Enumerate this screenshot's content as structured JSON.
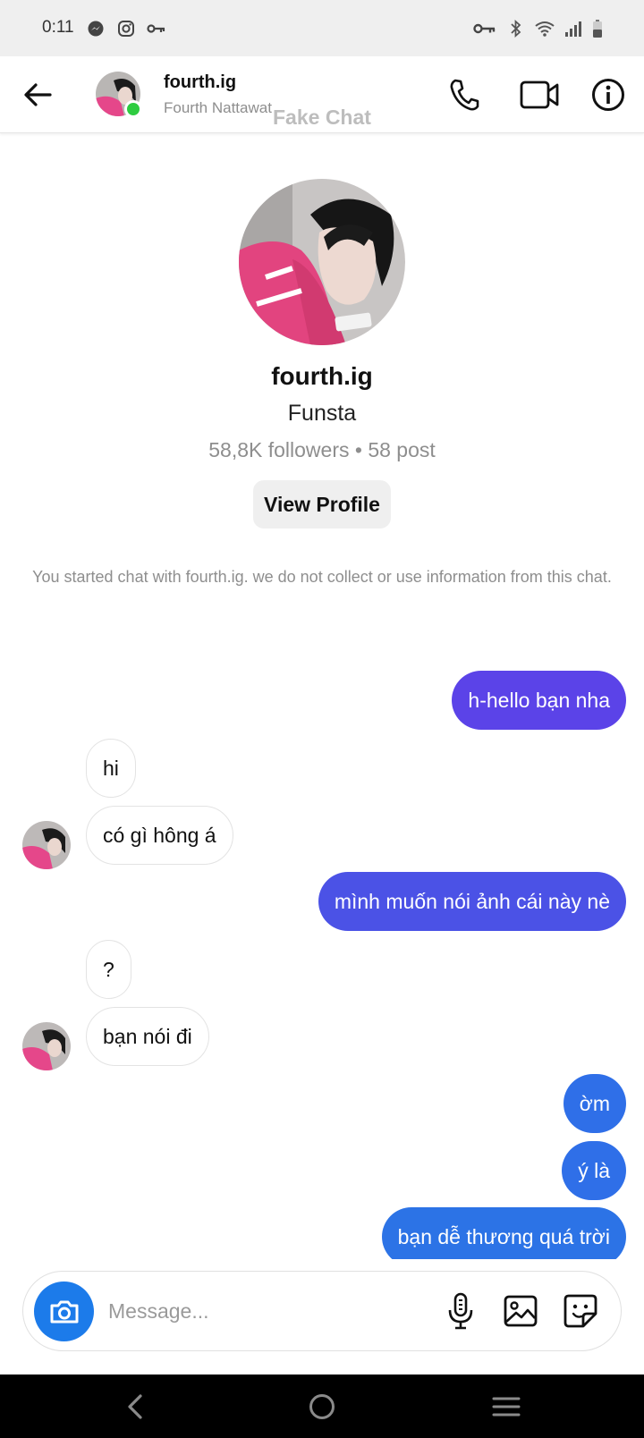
{
  "status_bar": {
    "time": "0:11",
    "left_icons": [
      "messenger-icon",
      "instagram-icon",
      "key-icon"
    ],
    "right_icons": [
      "vpn-key-icon",
      "bluetooth-icon",
      "wifi-icon",
      "signal-icon",
      "battery-icon"
    ]
  },
  "header": {
    "name": "fourth.ig",
    "subtitle": "Fourth Nattawat",
    "watermark": "Fake Chat",
    "online_color": "#2ecc40",
    "actions": [
      "phone-icon",
      "video-icon",
      "info-icon"
    ]
  },
  "profile": {
    "name": "fourth.ig",
    "tag": "Funsta",
    "stats": "58,8K followers • 58 post",
    "view_profile_label": "View Profile"
  },
  "notice": "You started chat with fourth.ig. we do not collect or use information from this chat.",
  "messages": [
    {
      "side": "out",
      "text": "h-hello bạn nha",
      "color": "#5b43e8"
    },
    {
      "side": "in",
      "text": "hi"
    },
    {
      "side": "in",
      "text": "có gì hông á"
    },
    {
      "side": "out",
      "text": "mình muốn nói ảnh cái này nè",
      "color": "#4b52e6"
    },
    {
      "side": "in",
      "text": "?"
    },
    {
      "side": "in",
      "text": "bạn nói đi"
    },
    {
      "side": "out",
      "text": "ờm",
      "color": "#2f6fe8"
    },
    {
      "side": "out",
      "text": "ý là",
      "color": "#2f6fe8"
    },
    {
      "side": "out",
      "text": "bạn dễ thương quá trời",
      "color": "#2c73e6"
    }
  ],
  "composer": {
    "placeholder": "Message...",
    "camera_color": "#1c7bea",
    "icons": [
      "microphone-icon",
      "gallery-icon",
      "sticker-icon"
    ]
  },
  "navbar": [
    "back-nav-icon",
    "home-nav-icon",
    "recents-nav-icon"
  ]
}
